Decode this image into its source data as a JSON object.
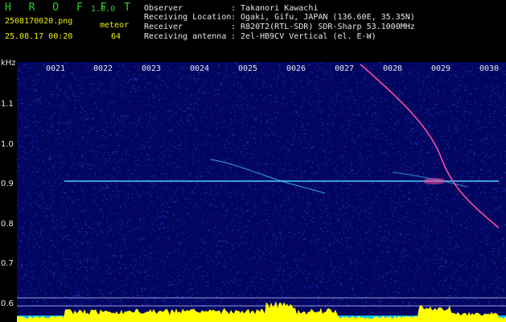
{
  "app": {
    "logo": "H R O F F T",
    "version": "1.0.0",
    "filename": "2508170020.png",
    "timestamp": "25.08.17 00:20",
    "meteor_label": "meteor",
    "meteor_count": "64"
  },
  "info": {
    "observer_label": "Observer",
    "observer_value": ": Takanori Kawachi",
    "location_label": "Receiving Location",
    "location_value": ": Ogaki, Gifu, JAPAN (136.60E, 35.35N)",
    "receiver_label": "Receiver",
    "receiver_value": ": R820T2(RTL-SDR) SDR-Sharp 53.1000MHz",
    "antenna_label": "Receiving antenna",
    "antenna_value": ": 2el-HB9CV Vertical (el. E-W)"
  },
  "plot": {
    "y_unit": "kHz",
    "y_ticks": [
      "1.1",
      "1.0",
      "0.9",
      "0.8",
      "0.7",
      "0.6"
    ],
    "x_ticks": [
      "0021",
      "0022",
      "0023",
      "0024",
      "0025",
      "0026",
      "0027",
      "0028",
      "0029",
      "0030"
    ],
    "colors": {
      "background": "#020660",
      "noise": "#2a40d8",
      "carrier": "#3fd0ff",
      "meteor_trail": "#ff4aa0",
      "power_trace": "#ffff00",
      "baseline": "#00c0ff",
      "grid_line": "#c0c0ff"
    }
  }
}
